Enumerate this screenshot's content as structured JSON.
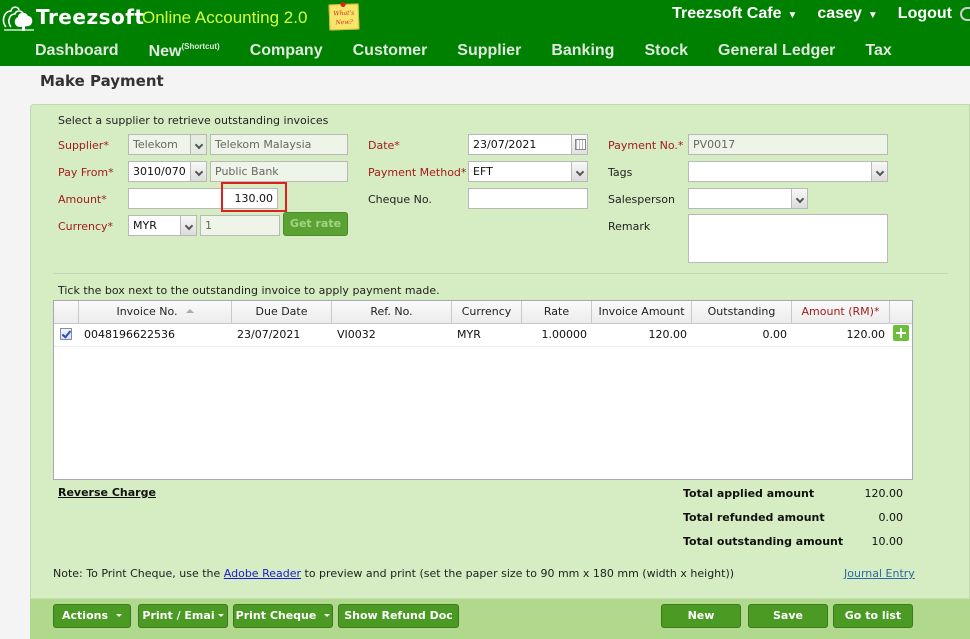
{
  "header": {
    "brand": "Treezsoft",
    "subtitle": "Online Accounting 2.0",
    "whats_new": "What's New?",
    "company": "Treezsoft Cafe",
    "user": "casey",
    "logout": "Logout",
    "caret": "▼"
  },
  "nav": {
    "items": [
      {
        "label": "Dashboard"
      },
      {
        "label": "New",
        "sup": "(Shortcut)"
      },
      {
        "label": "Company"
      },
      {
        "label": "Customer"
      },
      {
        "label": "Supplier"
      },
      {
        "label": "Banking"
      },
      {
        "label": "Stock"
      },
      {
        "label": "General Ledger"
      },
      {
        "label": "Tax"
      }
    ]
  },
  "page": {
    "title": "Make Payment"
  },
  "form": {
    "hint": "Select a supplier to retrieve outstanding invoices",
    "supplier": {
      "label": "Supplier*",
      "code": "Telekom",
      "name": "Telekom Malaysia"
    },
    "pay_from": {
      "label": "Pay From*",
      "code": "3010/070",
      "name": "Public Bank"
    },
    "amount": {
      "label": "Amount*",
      "value": "130.00"
    },
    "currency": {
      "label": "Currency*",
      "value": "MYR",
      "rate": "1",
      "get_rate": "Get rate"
    },
    "date": {
      "label": "Date*",
      "value": "23/07/2021"
    },
    "payment_method": {
      "label": "Payment Method*",
      "value": "EFT"
    },
    "cheque_no": {
      "label": "Cheque No.",
      "value": ""
    },
    "payment_no": {
      "label": "Payment No.*",
      "value": "PV0017"
    },
    "tags": {
      "label": "Tags",
      "value": ""
    },
    "salesperson": {
      "label": "Salesperson",
      "value": ""
    },
    "remark": {
      "label": "Remark",
      "value": ""
    }
  },
  "grid": {
    "hint": "Tick the box next to the outstanding invoice to apply payment made.",
    "columns": [
      "",
      "Invoice No.",
      "Due Date",
      "Ref. No.",
      "Currency",
      "Rate",
      "Invoice Amount",
      "Outstanding",
      "Amount (RM)*",
      ""
    ],
    "rows": [
      {
        "checked": true,
        "invoice_no": "0048196622536",
        "due_date": "23/07/2021",
        "ref_no": "VI0032",
        "currency": "MYR",
        "rate": "1.00000",
        "invoice_amount": "120.00",
        "outstanding": "0.00",
        "amount": "120.00"
      }
    ]
  },
  "summary": {
    "reverse_charge": "Reverse Charge",
    "applied_label": "Total applied amount",
    "applied_value": "120.00",
    "refunded_label": "Total refunded amount",
    "refunded_value": "0.00",
    "outstanding_label": "Total outstanding amount",
    "outstanding_value": "10.00"
  },
  "note": {
    "prefix": "Note: To Print Cheque, use the ",
    "link": "Adobe Reader",
    "suffix": " to preview and print (set the paper size to 90 mm x 180 mm (width x height))",
    "journal_entry": "Journal Entry"
  },
  "footer": {
    "actions": "Actions",
    "print_email": "Print / Emai",
    "print_cheque": "Print Cheque",
    "show_refund": "Show Refund Doc",
    "new": "New",
    "save": "Save",
    "go_to_list": "Go to list"
  }
}
